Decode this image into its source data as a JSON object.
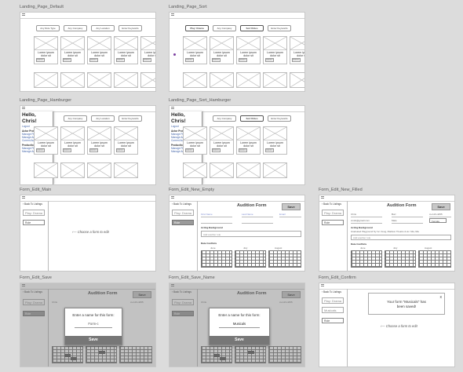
{
  "frames": {
    "lp_default": {
      "caption": "Landing_Page_Default",
      "filters": [
        "Any Role Type",
        "Any Company",
        "Any Location",
        "Enter Keywords"
      ]
    },
    "lp_sort": {
      "caption": "Landing_Page_Sort",
      "filters": [
        "Play: Drama",
        "Any Company",
        "Sort Roles",
        "Enter Keywords"
      ]
    },
    "lp_hamburger": {
      "caption": "Landing_Page_Hamburger",
      "filters": [
        "Any Company",
        "Any Location",
        "Enter Keywords"
      ]
    },
    "lp_sort_hamburger": {
      "caption": "Landing_Page_Sort_Hamburger",
      "filters": [
        "Any Company",
        "Sort Roles",
        "Enter Keywords"
      ]
    },
    "form_edit_main": {
      "caption": "Form_Edit_Main"
    },
    "form_edit_new_empty": {
      "caption": "Form_Edit_New_Empty"
    },
    "form_edit_new_filled": {
      "caption": "Form_Edit_New_Filled"
    },
    "form_edit_save": {
      "caption": "Form_Edit_Save"
    },
    "form_edit_save_name": {
      "caption": "Form_Edit_Save_Name"
    },
    "form_edit_confirm": {
      "caption": "Form_Edit_Confirm"
    }
  },
  "card": {
    "text": "Lorem ipsum dolor sit",
    "num": "000000"
  },
  "menu": {
    "hello": "Hello, Chris!",
    "logout": "Logout",
    "actor_title": "Actor Profile",
    "actor_items": [
      "Manage Profile",
      "Manage Audition Forms",
      "Current Auditions"
    ],
    "prod_title": "Production Profile",
    "prod_items": [
      "Manage Profile",
      "Manage Audition Listings"
    ]
  },
  "edit": {
    "back": "‹ Back To Listings",
    "play": "Play: Drama",
    "role": "Role",
    "musicals": "Musicals",
    "choose_hint": "‹— Choose a form to edit",
    "form_title": "Audition Form",
    "save": "Save",
    "acting_bg": "Acting Background",
    "date_conflicts": "Date Conflicts",
    "months": [
      "June",
      "July",
      "August"
    ],
    "fields": [
      "First Name",
      "Last Name",
      "Email"
    ],
    "add_more": "Add another role",
    "filled_fields": [
      "Chris",
      "Burr",
      "cs-123-4455",
      "cmsb@gmail.com",
      "Male",
      "Female"
    ],
    "bg_text": "Graduated Playground Ny Inc. Doug, Madison Theatre & etc. Mia, Mia",
    "modal_prompt": "Enter a name for this form:",
    "modal_placeholder": "Form-c",
    "modal_value": "Musicals",
    "modal_save": "Save",
    "confirm_msg_1": "Your form \"Musicals\" has",
    "confirm_msg_2": "been saved!",
    "close": "x"
  }
}
